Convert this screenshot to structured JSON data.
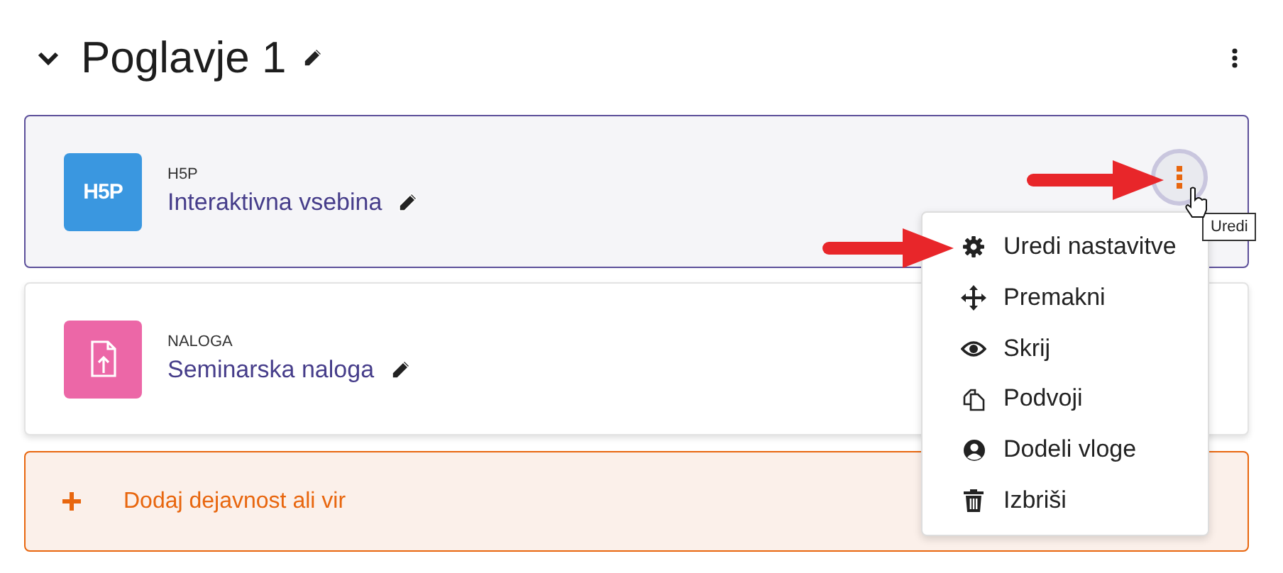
{
  "section": {
    "title": "Poglavje 1",
    "expanded": true
  },
  "activities": [
    {
      "kind": "h5p",
      "type": "H5P",
      "logo": "H5P",
      "name": "Interaktivna vsebina",
      "color": "#3a97e0",
      "highlighted": true
    },
    {
      "kind": "assignment",
      "type": "NALOGA",
      "name": "Seminarska naloga",
      "color": "#ec67a7",
      "highlighted": false
    }
  ],
  "add_button": {
    "label": "Dodaj dejavnost ali vir"
  },
  "action_menu": {
    "open": true,
    "tooltip": "Uredi",
    "items": [
      {
        "kind": "settings",
        "label": "Uredi nastavitve"
      },
      {
        "kind": "move",
        "label": "Premakni"
      },
      {
        "kind": "hide",
        "label": "Skrij"
      },
      {
        "kind": "duplicate",
        "label": "Podvoji"
      },
      {
        "kind": "roles",
        "label": "Dodeli vloge"
      },
      {
        "kind": "delete",
        "label": "Izbriši"
      }
    ]
  }
}
